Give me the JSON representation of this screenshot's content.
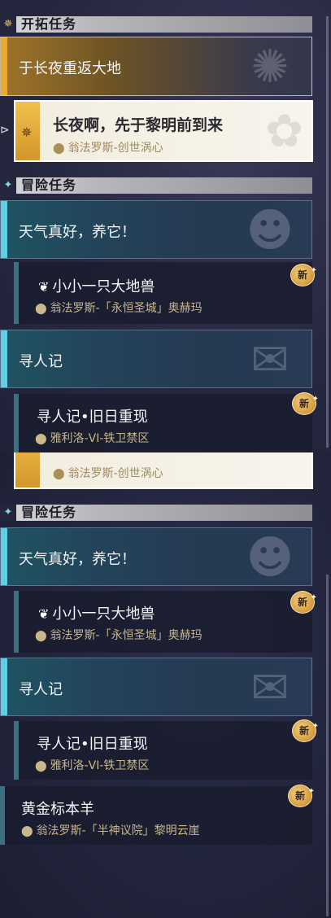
{
  "trailblaze": {
    "header": "开拓任务",
    "group_title": "于长夜重返大地",
    "selected_task": {
      "title": "长夜啊，先于黎明前到来",
      "location": "翁法罗斯-创世涡心"
    }
  },
  "adventure": {
    "header": "冒险任务",
    "groups": [
      {
        "title": "天气真好，养它！",
        "task": {
          "title": "小小一只大地兽",
          "location": "翁法罗斯-「永恒圣城」奥赫玛",
          "badge": "新"
        }
      },
      {
        "title": "寻人记",
        "task": {
          "title": "寻人记•旧日重现",
          "location": "雅利洛-VI-铁卫禁区",
          "badge": "新"
        }
      }
    ],
    "extra_task": {
      "title": "黄金标本羊",
      "location": "翁法罗斯-「半神议院」黎明云崖",
      "badge": "新"
    }
  },
  "icons": {
    "pin": "location-pin-icon",
    "new": "new-badge-icon",
    "trailblaze": "trailblaze-mission-icon",
    "adventure": "adventure-mission-icon"
  },
  "colors": {
    "gold": "#e8aa32",
    "teal": "#5fd0e4",
    "location_text": "#c9b889",
    "badge": "#d49a3a"
  }
}
